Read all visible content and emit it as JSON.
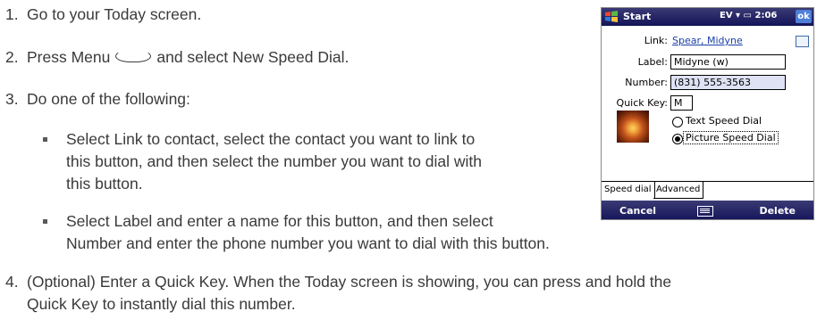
{
  "steps": [
    {
      "num": "1.",
      "text": "Go to your Today screen."
    },
    {
      "num": "2.",
      "text_before": "Press Menu",
      "text_after": "and select New Speed Dial."
    },
    {
      "num": "3.",
      "text": "Do one of the following:"
    },
    {
      "num": "4.",
      "line1": "(Optional) Enter a Quick Key. When the Today screen is showing, you can press and hold the",
      "line2": "Quick Key to instantly dial this number."
    }
  ],
  "bullets": [
    {
      "line1": "Select Link to contact, select the contact you want to link to",
      "line2": "this button, and then select the number you want to dial with",
      "line3": "this button."
    },
    {
      "line1": "Select Label and enter a name for this button, and then select",
      "line2": "Number and enter the phone number you want to dial with this button."
    }
  ],
  "device": {
    "title": "Start",
    "status": "EV ▾ ▭ 2:06",
    "ok_label": "ok",
    "link_label": "Link:",
    "link_value": "Spear, Midyne",
    "label_label": "Label:",
    "label_value": "Midyne (w)",
    "number_label": "Number:",
    "number_value": "(831) 555-3563",
    "quickkey_label": "Quick Key:",
    "quickkey_value": "M",
    "radio_text": "Text Speed Dial",
    "radio_picture": "Picture Speed Dial",
    "selected_mode": "Picture Speed Dial",
    "tabs": [
      "Speed dial",
      "Advanced"
    ],
    "soft_left": "Cancel",
    "soft_right": "Delete",
    "accent": "#1a1a60"
  }
}
